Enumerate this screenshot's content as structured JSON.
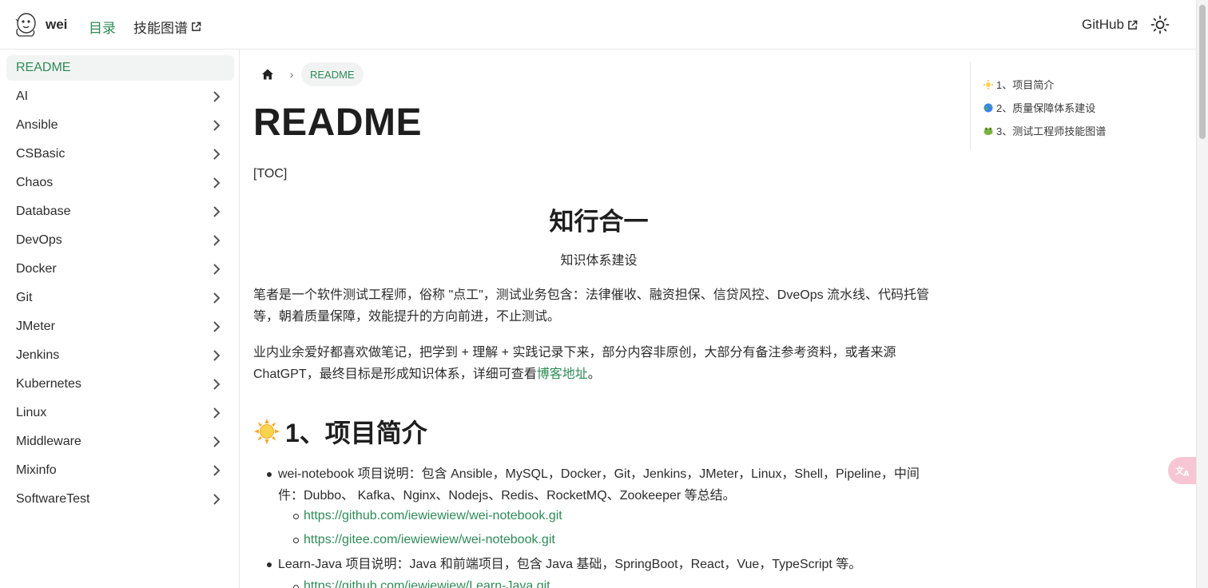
{
  "nav": {
    "site_name": "wei",
    "links": [
      {
        "label": "目录",
        "active": true
      },
      {
        "label": "技能图谱",
        "external": true
      }
    ],
    "github": {
      "label": "GitHub"
    },
    "accent_color": "#2e8b57"
  },
  "sidebar": {
    "items": [
      {
        "label": "README",
        "active": true
      },
      {
        "label": "AI"
      },
      {
        "label": "Ansible"
      },
      {
        "label": "CSBasic"
      },
      {
        "label": "Chaos"
      },
      {
        "label": "Database"
      },
      {
        "label": "DevOps"
      },
      {
        "label": "Docker"
      },
      {
        "label": "Git"
      },
      {
        "label": "JMeter"
      },
      {
        "label": "Jenkins"
      },
      {
        "label": "Kubernetes"
      },
      {
        "label": "Linux"
      },
      {
        "label": "Middleware"
      },
      {
        "label": "Mixinfo"
      },
      {
        "label": "SoftwareTest"
      }
    ]
  },
  "breadcrumb": {
    "current": "README"
  },
  "content": {
    "title": "README",
    "toc_marker": "[TOC]",
    "motto": "知行合一",
    "motto_sub": "知识体系建设",
    "para1": "笔者是一个软件测试工程师，俗称 \"点工\"，测试业务包含：法律催收、融资担保、信贷风控、DveOps 流水线、代码托管等，朝着质量保障，效能提升的方向前进，不止测试。",
    "para2_prefix": "业内业余爱好都喜欢做笔记，把学到 + 理解 + 实践记录下来，部分内容非原创，大部分有备注参考资料，或者来源 ChatGPT，最终目标是形成知识体系，详细可查看",
    "para2_link": "博客地址",
    "para2_suffix": "。",
    "section1_title": "1、项目简介",
    "list": [
      {
        "text": "wei-notebook 项目说明：包含 Ansible，MySQL，Docker，Git，Jenkins，JMeter，Linux，Shell，Pipeline，中间件：Dubbo、 Kafka、Nginx、Nodejs、Redis、RocketMQ、Zookeeper 等总结。",
        "links": [
          "https://github.com/iewiewiew/wei-notebook.git",
          "https://gitee.com/iewiewiew/wei-notebook.git"
        ]
      },
      {
        "text": "Learn-Java 项目说明：Java 和前端项目，包含 Java 基础，SpringBoot，React，Vue，TypeScript 等。",
        "links": [
          "https://github.com/iewiewiew/Learn-Java.git"
        ]
      }
    ]
  },
  "toc": {
    "items": [
      {
        "emoji": "sun-emoji",
        "label": "1、项目简介"
      },
      {
        "emoji": "globe-emoji",
        "label": "2、质量保障体系建设"
      },
      {
        "emoji": "frog-emoji",
        "label": "3、测试工程师技能图谱"
      }
    ]
  }
}
